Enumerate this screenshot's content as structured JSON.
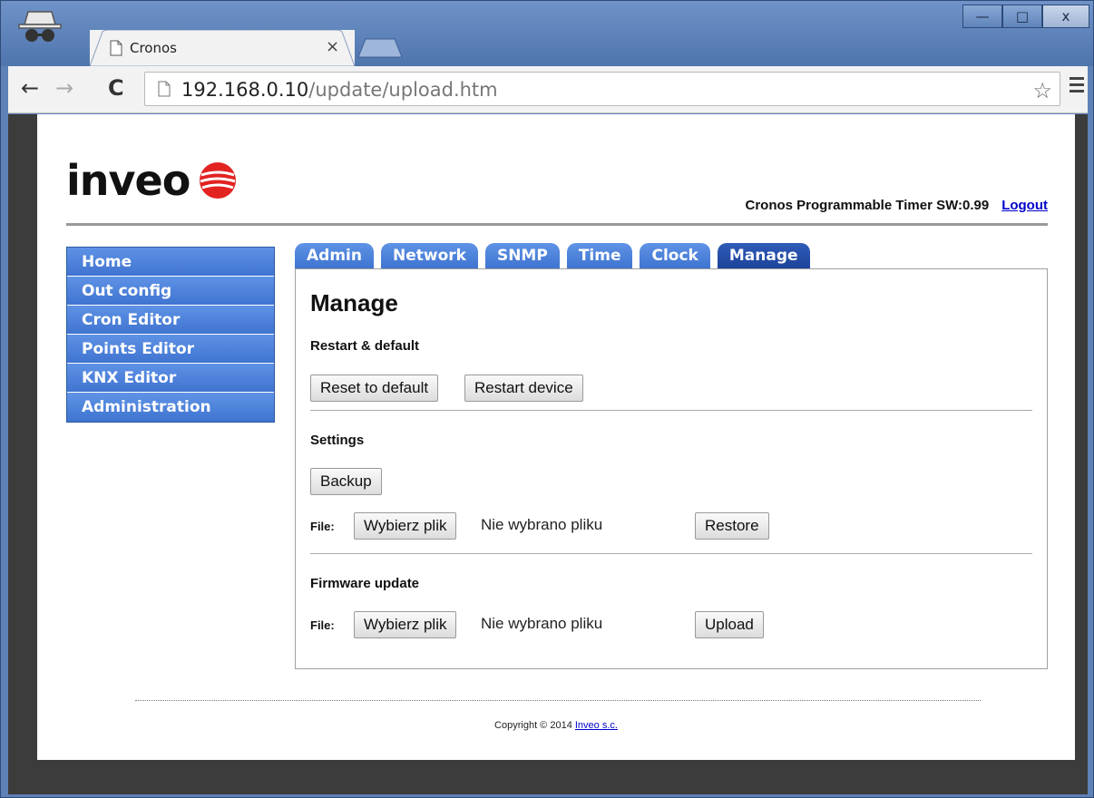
{
  "browser": {
    "tab_title": "Cronos",
    "tab_close": "×",
    "url_host": "192.168.0.10",
    "url_path": "/update/upload.htm",
    "back": "←",
    "forward": "→",
    "reload": "C",
    "bookmark": "☆",
    "window_min": "—",
    "window_max": "□",
    "window_close": "x"
  },
  "header": {
    "logo_text": "inveo",
    "info": "Cronos Programmable Timer SW:0.99",
    "logout": "Logout"
  },
  "sidebar": {
    "items": [
      {
        "label": "Home"
      },
      {
        "label": "Out config"
      },
      {
        "label": "Cron Editor"
      },
      {
        "label": "Points Editor"
      },
      {
        "label": "KNX Editor"
      },
      {
        "label": "Administration"
      }
    ]
  },
  "tabs": [
    {
      "label": "Admin"
    },
    {
      "label": "Network"
    },
    {
      "label": "SNMP"
    },
    {
      "label": "Time"
    },
    {
      "label": "Clock"
    },
    {
      "label": "Manage",
      "active": true
    }
  ],
  "main": {
    "title": "Manage",
    "restart_section": "Restart & default",
    "reset_button": "Reset to default",
    "restart_button": "Restart device",
    "settings_section": "Settings",
    "backup_button": "Backup",
    "file_label": "File:",
    "choose_file": "Wybierz plik",
    "no_file": "Nie wybrano pliku",
    "restore_button": "Restore",
    "firmware_section": "Firmware update",
    "upload_button": "Upload"
  },
  "footer": {
    "copyright": "Copyright © 2014",
    "company": "Inveo s.c."
  },
  "colors": {
    "menu_blue": "#4a7fd9",
    "active_tab": "#1d439a",
    "logo_red": "#e32222"
  }
}
